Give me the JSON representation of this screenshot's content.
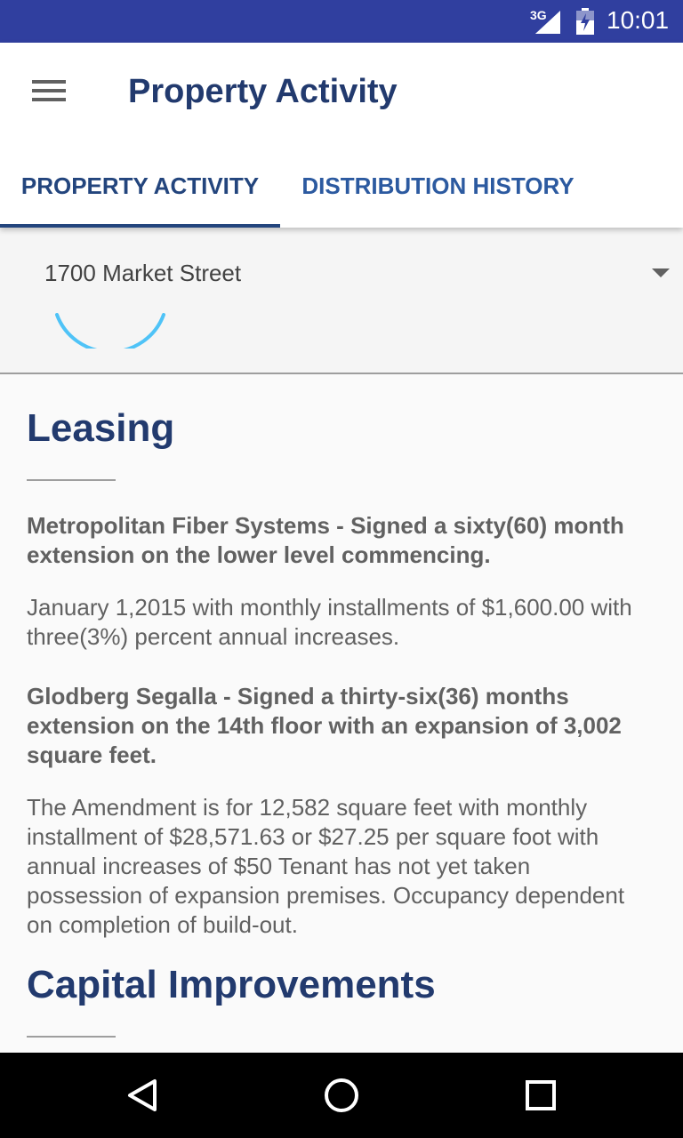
{
  "status_bar": {
    "network": "3G",
    "time": "10:01",
    "icons": [
      "signal-icon",
      "battery-icon"
    ]
  },
  "app_bar": {
    "title": "Property Activity",
    "menu_icon": "hamburger-menu-icon"
  },
  "tabs": [
    {
      "label": "PROPERTY ACTIVITY",
      "selected": true
    },
    {
      "label": "DISTRIBUTION HISTORY",
      "selected": false
    }
  ],
  "property_selector": {
    "selected_value": "1700 Market Street",
    "dropdown_icon": "dropdown-arrow-icon",
    "loading": true
  },
  "sections": [
    {
      "title": "Leasing",
      "paragraphs": [
        {
          "text": "Metropolitan Fiber Systems - Signed a sixty(60) month extension on the lower level commencing.",
          "bold": true
        },
        {
          "text": "January 1,2015 with monthly installments of $1,600.00 with three(3%) percent annual increases.",
          "bold": false
        },
        {
          "text": "Glodberg Segalla - Signed a thirty-six(36) months extension on the 14th floor with an expansion of 3,002 square feet.",
          "bold": true
        },
        {
          "text": "The Amendment is for 12,582 square feet with monthly installment of $28,571.63 or $27.25 per square foot with annual increases of $50 Tenant has not yet taken possession of expansion premises. Occupancy dependent on completion of build-out.",
          "bold": false
        }
      ]
    },
    {
      "title": "Capital Improvements",
      "paragraphs": []
    }
  ],
  "nav_bar": {
    "icons": [
      "back-icon",
      "home-icon",
      "recents-icon"
    ]
  },
  "colors": {
    "status_bar": "#303f9f",
    "accent": "#223a6e",
    "tab_text": "#2c5aa0",
    "spinner": "#4fc3f7",
    "body_text": "#616161"
  }
}
